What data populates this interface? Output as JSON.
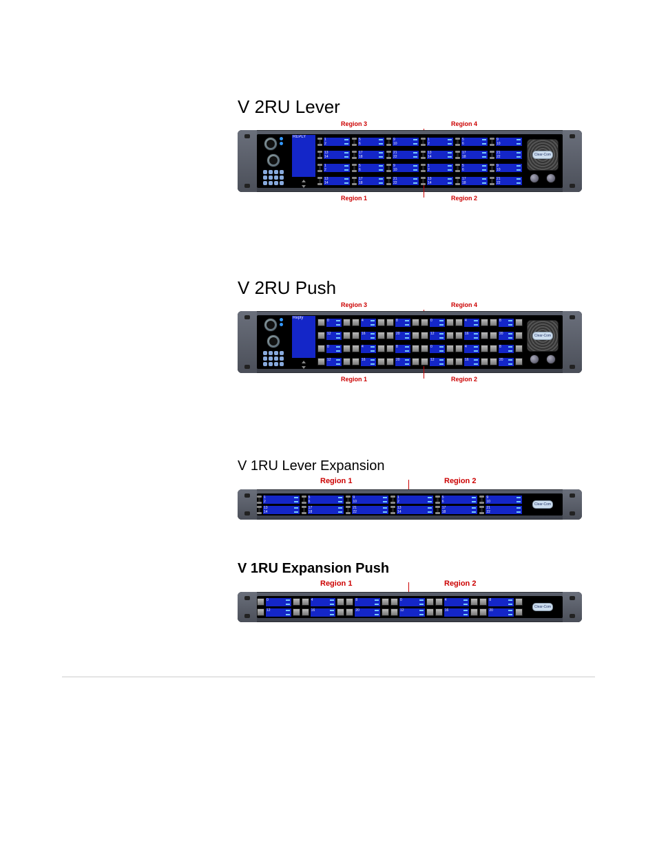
{
  "sections": [
    {
      "title": "V 2RU Lever",
      "bold": false,
      "rack_height": "2RU",
      "key_style": "lever",
      "has_controls": true,
      "has_speaker": true,
      "rows": 4,
      "cols_per_region": 3,
      "regions_wide": 2,
      "top_region_labels": [
        "Region 3",
        "Region 4"
      ],
      "bottom_region_labels": [
        "Region 1",
        "Region 2"
      ],
      "reply_label": "REPLY",
      "logo_text": "Clear-Com",
      "row_display_values": [
        [
          [
            "1",
            "2"
          ],
          [
            "5",
            "6"
          ],
          [
            "9",
            "10"
          ],
          [
            "1",
            "2"
          ],
          [
            "5",
            "6"
          ],
          [
            "9",
            "10"
          ]
        ],
        [
          [
            "13",
            "14"
          ],
          [
            "17",
            "18"
          ],
          [
            "21",
            "22"
          ],
          [
            "13",
            "14"
          ],
          [
            "17",
            "18"
          ],
          [
            "21",
            "22"
          ]
        ],
        [
          [
            "1",
            "2"
          ],
          [
            "5",
            "6"
          ],
          [
            "9",
            "10"
          ],
          [
            "1",
            "2"
          ],
          [
            "5",
            "6"
          ],
          [
            "9",
            "10"
          ]
        ],
        [
          [
            "13",
            "14"
          ],
          [
            "17",
            "18"
          ],
          [
            "21",
            "22"
          ],
          [
            "13",
            "14"
          ],
          [
            "17",
            "18"
          ],
          [
            "21",
            "22"
          ]
        ]
      ]
    },
    {
      "title": "V 2RU Push",
      "bold": false,
      "rack_height": "2RU",
      "key_style": "push",
      "has_controls": true,
      "has_speaker": true,
      "rows": 4,
      "cols_per_region": 3,
      "regions_wide": 2,
      "top_region_labels": [
        "Region 3",
        "Region 4"
      ],
      "bottom_region_labels": [
        "Region 1",
        "Region 2"
      ],
      "reply_label": "Reply",
      "logo_text": "Clear-Com",
      "row_display_values": [
        [
          [
            "0",
            ""
          ],
          [
            "4",
            ""
          ],
          [
            "8",
            ""
          ],
          [
            "0",
            ""
          ],
          [
            "4",
            ""
          ],
          [
            "8",
            ""
          ]
        ],
        [
          [
            "12",
            ""
          ],
          [
            "16",
            ""
          ],
          [
            "20",
            ""
          ],
          [
            "12",
            ""
          ],
          [
            "16",
            ""
          ],
          [
            "20",
            ""
          ]
        ],
        [
          [
            "0",
            ""
          ],
          [
            "4",
            ""
          ],
          [
            "8",
            ""
          ],
          [
            "0",
            ""
          ],
          [
            "4",
            ""
          ],
          [
            "8",
            ""
          ]
        ],
        [
          [
            "12",
            ""
          ],
          [
            "16",
            ""
          ],
          [
            "20",
            ""
          ],
          [
            "12",
            ""
          ],
          [
            "16",
            ""
          ],
          [
            "20",
            ""
          ]
        ]
      ]
    },
    {
      "title": "V 1RU Lever Expansion",
      "bold": false,
      "rack_height": "1RU",
      "key_style": "lever",
      "has_controls": false,
      "has_speaker": false,
      "has_logo_right": true,
      "rows": 2,
      "cols_per_region": 3,
      "regions_wide": 2,
      "top_region_labels": [
        "Region 1",
        "Region 2"
      ],
      "bottom_region_labels": [],
      "logo_text": "Clear-Com",
      "row_display_values": [
        [
          [
            "1",
            "2"
          ],
          [
            "5",
            "6"
          ],
          [
            "9",
            "10"
          ],
          [
            "1",
            "2"
          ],
          [
            "5",
            "6"
          ],
          [
            "9",
            "10"
          ]
        ],
        [
          [
            "13",
            "14"
          ],
          [
            "17",
            "18"
          ],
          [
            "21",
            "22"
          ],
          [
            "13",
            "14"
          ],
          [
            "17",
            "18"
          ],
          [
            "21",
            "22"
          ]
        ]
      ]
    },
    {
      "title": "V 1RU Expansion Push",
      "bold": true,
      "rack_height": "1RU",
      "key_style": "push",
      "has_controls": false,
      "has_speaker": false,
      "has_logo_right": true,
      "rows": 2,
      "cols_per_region": 3,
      "regions_wide": 2,
      "top_region_labels": [
        "Region 1",
        "Region 2"
      ],
      "bottom_region_labels": [],
      "logo_text": "Clear-Com",
      "row_display_values": [
        [
          [
            "0",
            ""
          ],
          [
            "4",
            ""
          ],
          [
            "8",
            ""
          ],
          [
            "0",
            ""
          ],
          [
            "4",
            ""
          ],
          [
            "8",
            ""
          ]
        ],
        [
          [
            "12",
            ""
          ],
          [
            "16",
            ""
          ],
          [
            "20",
            ""
          ],
          [
            "12",
            ""
          ],
          [
            "16",
            ""
          ],
          [
            "20",
            ""
          ]
        ]
      ]
    }
  ]
}
